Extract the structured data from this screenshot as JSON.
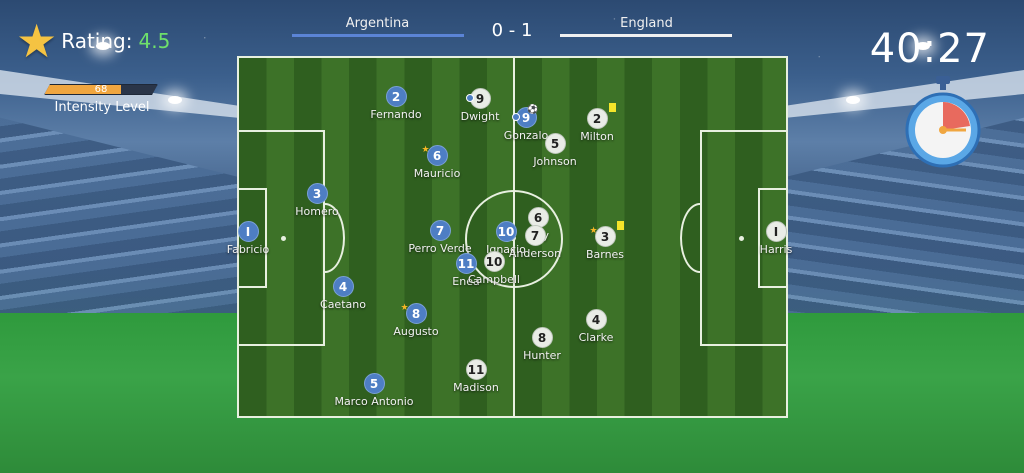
{
  "match": {
    "home_team": "Argentina",
    "away_team": "England",
    "score": "0 - 1",
    "clock": "40:27"
  },
  "hud": {
    "rating_label": "Rating:",
    "rating_value": "4.5",
    "intensity_value": "68",
    "intensity_fraction": 0.68,
    "intensity_label": "Intensity Level",
    "colors": {
      "home": "#4e7ec4",
      "away": "#e9ece6",
      "rating": "#6ee06b",
      "intensity": "#f0a640"
    }
  },
  "home_players": [
    {
      "num": "I",
      "name": "Fabricio"
    },
    {
      "num": "2",
      "name": "Fernando"
    },
    {
      "num": "3",
      "name": "Homero"
    },
    {
      "num": "4",
      "name": "Caetano"
    },
    {
      "num": "5",
      "name": "Marco Antonio"
    },
    {
      "num": "6",
      "name": "Mauricio",
      "star": true
    },
    {
      "num": "7",
      "name": "Perro Verde"
    },
    {
      "num": "8",
      "name": "Augusto",
      "star": true
    },
    {
      "num": "9",
      "name": "Gonzalo",
      "ball": true,
      "captain": true
    },
    {
      "num": "10",
      "name": "Ignacio"
    },
    {
      "num": "11",
      "name": "Enea"
    }
  ],
  "away_players": [
    {
      "num": "I",
      "name": "Harris"
    },
    {
      "num": "2",
      "name": "Milton",
      "card": "yellow"
    },
    {
      "num": "3",
      "name": "Barnes",
      "card": "yellow",
      "star": true
    },
    {
      "num": "4",
      "name": "Clarke"
    },
    {
      "num": "5",
      "name": "Johnson"
    },
    {
      "num": "6",
      "name": "Guy"
    },
    {
      "num": "7",
      "name": "Anderson"
    },
    {
      "num": "8",
      "name": "Hunter"
    },
    {
      "num": "9",
      "name": "Dwight",
      "captain": true
    },
    {
      "num": "10",
      "name": "Campbell"
    },
    {
      "num": "11",
      "name": "Madison"
    }
  ],
  "icons": {
    "rating": "star-icon",
    "clock": "stopwatch-icon",
    "ball": "ball-icon",
    "card": "yellow-card-icon"
  }
}
